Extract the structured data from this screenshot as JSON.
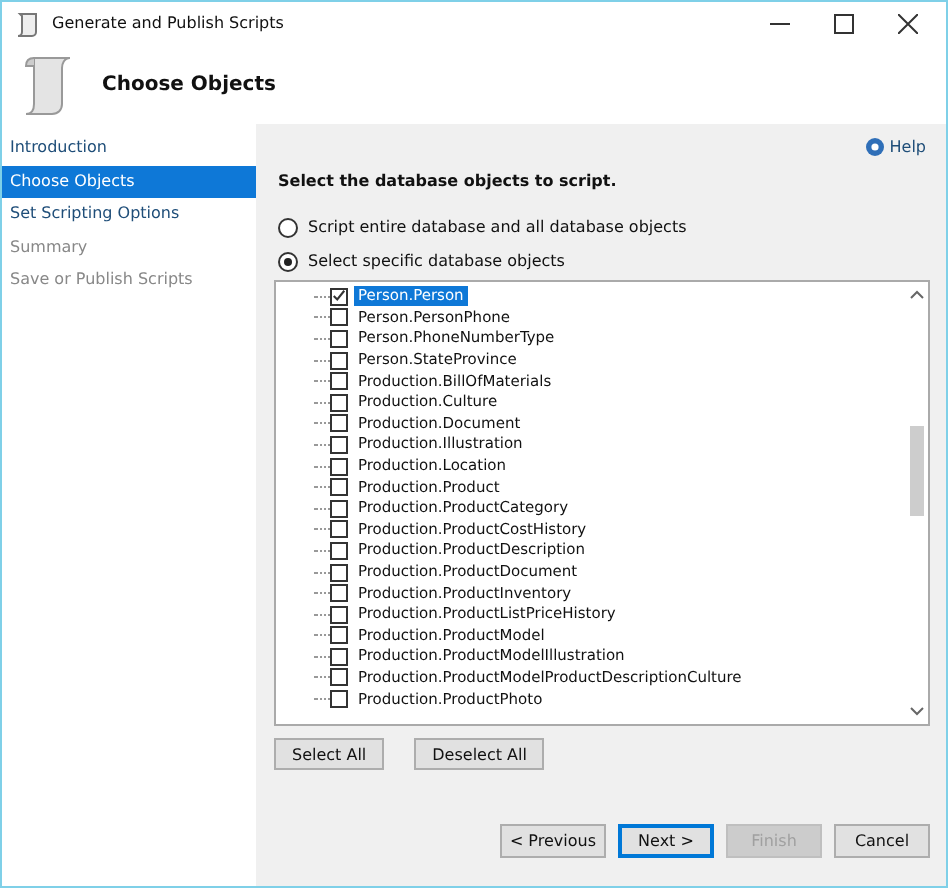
{
  "window": {
    "title": "Generate and Publish Scripts"
  },
  "header": {
    "title": "Choose Objects"
  },
  "sidebar": {
    "items": [
      {
        "label": "Introduction",
        "selected": false,
        "disabled": false
      },
      {
        "label": "Choose Objects",
        "selected": true,
        "disabled": false
      },
      {
        "label": "Set Scripting Options",
        "selected": false,
        "disabled": false
      },
      {
        "label": "Summary",
        "selected": false,
        "disabled": true
      },
      {
        "label": "Save or Publish Scripts",
        "selected": false,
        "disabled": true
      }
    ]
  },
  "help": "Help",
  "instruction": "Select the database objects to script.",
  "options": [
    {
      "label": "Script entire database and all database objects",
      "selected": false
    },
    {
      "label": "Select specific database objects",
      "selected": true
    }
  ],
  "tree": {
    "items": [
      {
        "label": "Person.Person",
        "checked": true,
        "selected": true
      },
      {
        "label": "Person.PersonPhone",
        "checked": false,
        "selected": false
      },
      {
        "label": "Person.PhoneNumberType",
        "checked": false,
        "selected": false
      },
      {
        "label": "Person.StateProvince",
        "checked": false,
        "selected": false
      },
      {
        "label": "Production.BillOfMaterials",
        "checked": false,
        "selected": false
      },
      {
        "label": "Production.Culture",
        "checked": false,
        "selected": false
      },
      {
        "label": "Production.Document",
        "checked": false,
        "selected": false
      },
      {
        "label": "Production.Illustration",
        "checked": false,
        "selected": false
      },
      {
        "label": "Production.Location",
        "checked": false,
        "selected": false
      },
      {
        "label": "Production.Product",
        "checked": false,
        "selected": false
      },
      {
        "label": "Production.ProductCategory",
        "checked": false,
        "selected": false
      },
      {
        "label": "Production.ProductCostHistory",
        "checked": false,
        "selected": false
      },
      {
        "label": "Production.ProductDescription",
        "checked": false,
        "selected": false
      },
      {
        "label": "Production.ProductDocument",
        "checked": false,
        "selected": false
      },
      {
        "label": "Production.ProductInventory",
        "checked": false,
        "selected": false
      },
      {
        "label": "Production.ProductListPriceHistory",
        "checked": false,
        "selected": false
      },
      {
        "label": "Production.ProductModel",
        "checked": false,
        "selected": false
      },
      {
        "label": "Production.ProductModelIllustration",
        "checked": false,
        "selected": false
      },
      {
        "label": "Production.ProductModelProductDescriptionCulture",
        "checked": false,
        "selected": false
      },
      {
        "label": "Production.ProductPhoto",
        "checked": false,
        "selected": false
      }
    ]
  },
  "list_buttons": [
    "Select All",
    "Deselect All"
  ],
  "footer_buttons": [
    {
      "label": "< Previous",
      "disabled": false,
      "focused": false
    },
    {
      "label": "Next >",
      "disabled": false,
      "focused": true
    },
    {
      "label": "Finish",
      "disabled": true,
      "focused": false
    },
    {
      "label": "Cancel",
      "disabled": false,
      "focused": false
    }
  ]
}
